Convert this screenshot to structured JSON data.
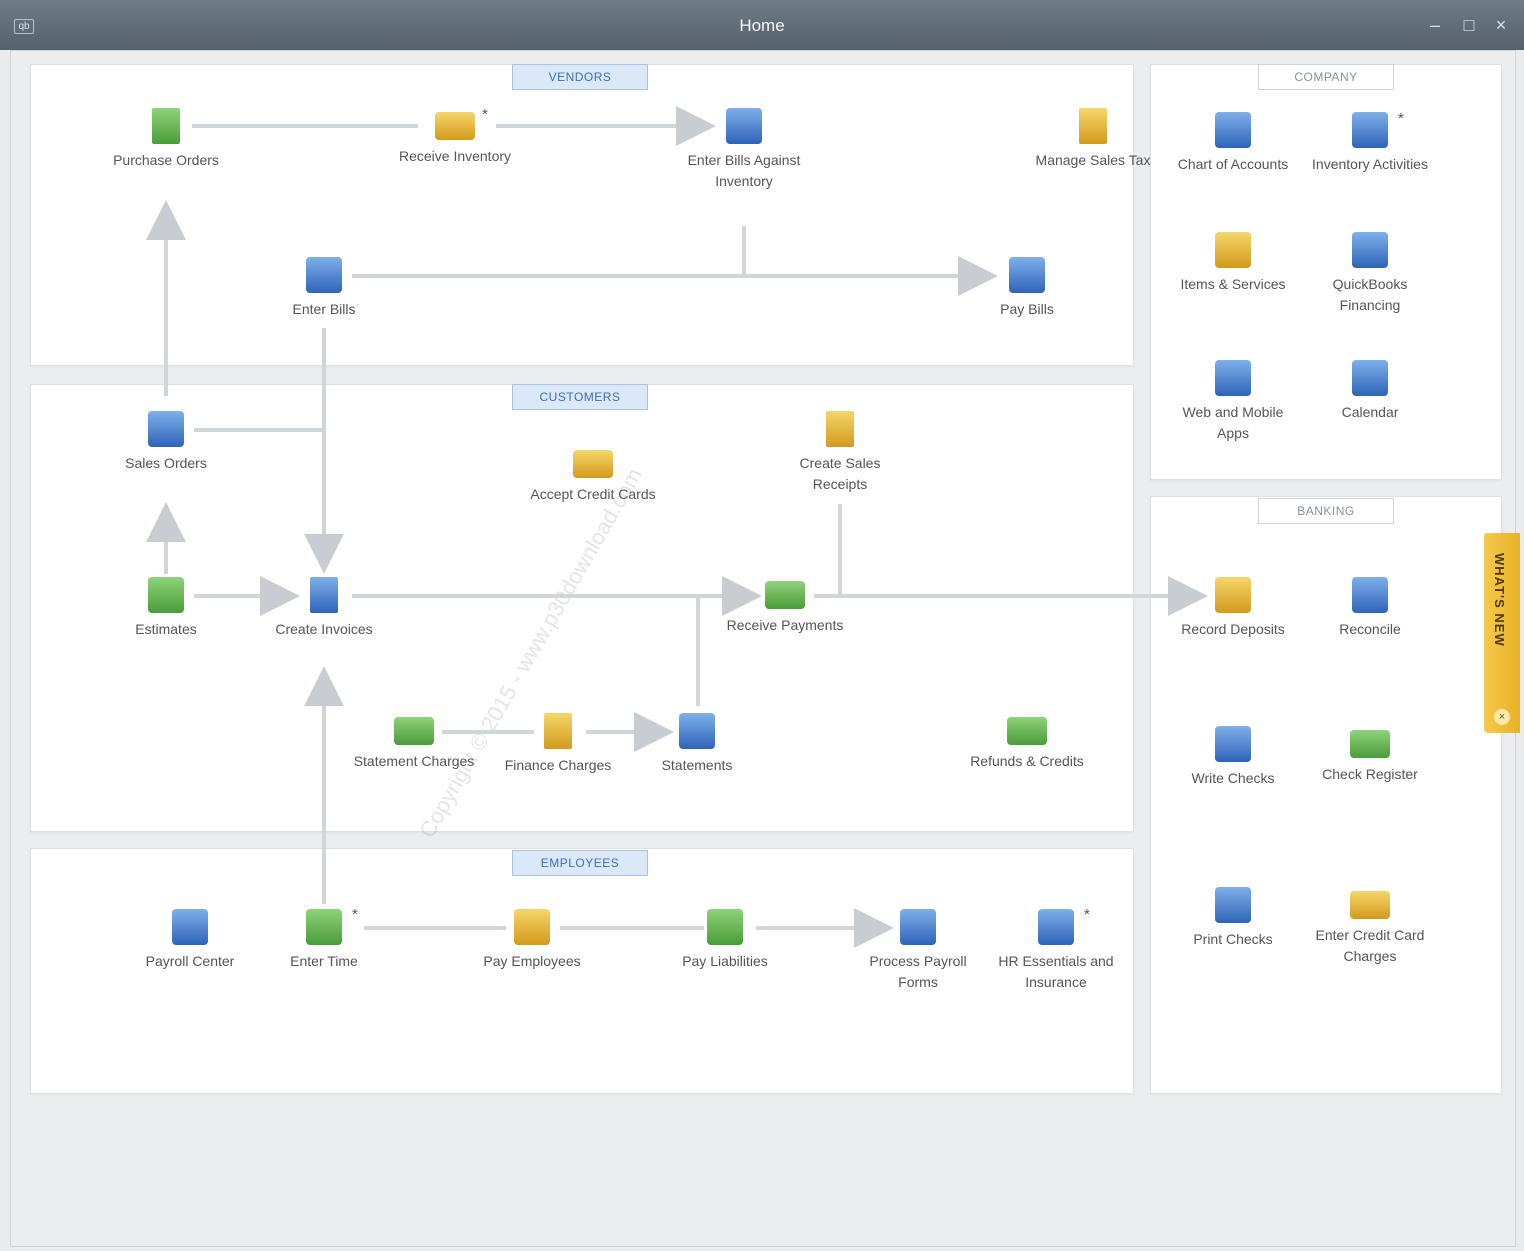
{
  "window": {
    "title": "Home",
    "minimize": "–",
    "maximize": "□",
    "close": "×",
    "sys_icon": "qb"
  },
  "sections": {
    "vendors": "VENDORS",
    "customers": "CUSTOMERS",
    "employees": "EMPLOYEES",
    "company": "COMPANY",
    "banking": "BANKING"
  },
  "vendors": {
    "purchase_orders": "Purchase Orders",
    "receive_inventory": "Receive Inventory",
    "enter_bills_against_inventory": "Enter Bills Against Inventory",
    "manage_sales_tax": "Manage Sales Tax",
    "enter_bills": "Enter Bills",
    "pay_bills": "Pay Bills"
  },
  "customers": {
    "sales_orders": "Sales Orders",
    "accept_credit_cards": "Accept Credit Cards",
    "create_sales_receipts": "Create Sales Receipts",
    "estimates": "Estimates",
    "create_invoices": "Create Invoices",
    "receive_payments": "Receive Payments",
    "statement_charges": "Statement Charges",
    "finance_charges": "Finance Charges",
    "statements": "Statements",
    "refunds_credits": "Refunds & Credits"
  },
  "employees": {
    "payroll_center": "Payroll Center",
    "enter_time": "Enter Time",
    "pay_employees": "Pay Employees",
    "pay_liabilities": "Pay Liabilities",
    "process_payroll_forms": "Process Payroll Forms",
    "hr_essentials": "HR Essentials and Insurance"
  },
  "company": {
    "chart_of_accounts": "Chart of Accounts",
    "inventory_activities": "Inventory Activities",
    "items_services": "Items & Services",
    "quickbooks_financing": "QuickBooks Financing",
    "web_mobile_apps": "Web and Mobile Apps",
    "calendar": "Calendar"
  },
  "banking": {
    "record_deposits": "Record Deposits",
    "reconcile": "Reconcile",
    "write_checks": "Write Checks",
    "check_register": "Check Register",
    "print_checks": "Print Checks",
    "enter_credit_card_charges": "Enter Credit Card Charges"
  },
  "star": "*",
  "whats_new": {
    "label": "WHAT'S NEW",
    "close": "×"
  },
  "watermark": "Copyright © 2015 - www.p30download.com",
  "colors": {
    "section_label_blue": "#3d6fb5",
    "whats_new_tab": "#f6c84b",
    "icon_green": "#4a9c3b",
    "icon_yellow": "#d39a1c",
    "icon_blue": "#2f63b8"
  }
}
